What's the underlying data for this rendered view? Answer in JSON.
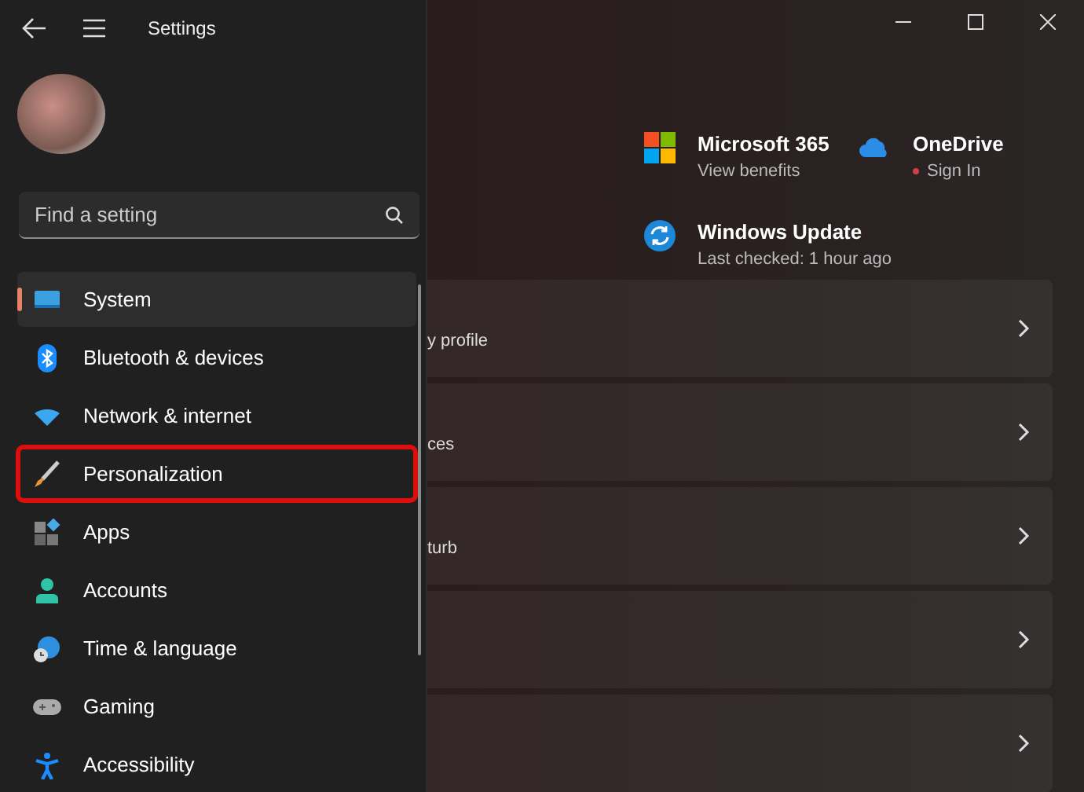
{
  "window": {
    "title": "Settings"
  },
  "search": {
    "placeholder": "Find a setting"
  },
  "nav": [
    {
      "label": "System",
      "selected": true,
      "highlighted": false
    },
    {
      "label": "Bluetooth & devices",
      "selected": false,
      "highlighted": false
    },
    {
      "label": "Network & internet",
      "selected": false,
      "highlighted": false
    },
    {
      "label": "Personalization",
      "selected": false,
      "highlighted": true
    },
    {
      "label": "Apps",
      "selected": false,
      "highlighted": false
    },
    {
      "label": "Accounts",
      "selected": false,
      "highlighted": false
    },
    {
      "label": "Time & language",
      "selected": false,
      "highlighted": false
    },
    {
      "label": "Gaming",
      "selected": false,
      "highlighted": false
    },
    {
      "label": "Accessibility",
      "selected": false,
      "highlighted": false
    }
  ],
  "tiles": [
    {
      "title": "Microsoft 365",
      "subtitle": "View benefits",
      "alert": false
    },
    {
      "title": "OneDrive",
      "subtitle": "Sign In",
      "alert": true
    },
    {
      "title": "Windows Update",
      "subtitle": "Last checked: 1 hour ago",
      "alert": false
    }
  ],
  "cards": [
    {
      "text": "y profile",
      "chevron": true
    },
    {
      "text": "ces",
      "chevron": true
    },
    {
      "text": "turb",
      "chevron": true
    },
    {
      "chevron": true
    },
    {
      "chevron": true
    }
  ]
}
